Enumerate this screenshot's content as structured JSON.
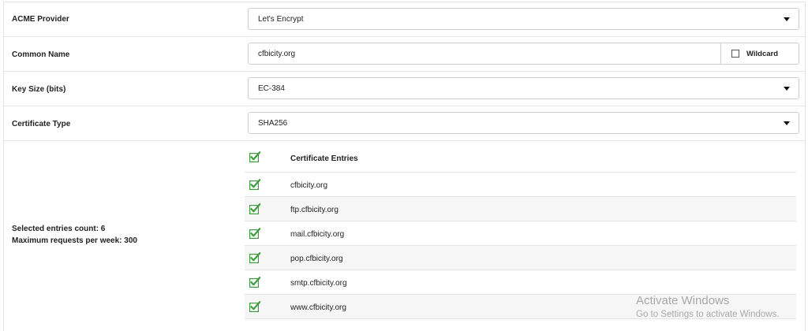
{
  "form": {
    "acme_provider": {
      "label": "ACME Provider",
      "value": "Let's Encrypt"
    },
    "common_name": {
      "label": "Common Name",
      "value": "cfbicity.org",
      "wildcard_label": "Wildcard",
      "wildcard_checked": false
    },
    "key_size": {
      "label": "Key Size (bits)",
      "value": "EC-384"
    },
    "certificate_type": {
      "label": "Certificate Type",
      "value": "SHA256"
    }
  },
  "entries": {
    "header": "Certificate Entries",
    "items": [
      "cfbicity.org",
      "ftp.cfbicity.org",
      "mail.cfbicity.org",
      "pop.cfbicity.org",
      "smtp.cfbicity.org",
      "www.cfbicity.org"
    ],
    "check_color": "#3f9b3f"
  },
  "summary": {
    "selected_count": "Selected entries count: 6",
    "max_requests": "Maximum requests per week: 300"
  },
  "watermark": {
    "title": "Activate Windows",
    "subtitle": "Go to Settings to activate Windows."
  }
}
